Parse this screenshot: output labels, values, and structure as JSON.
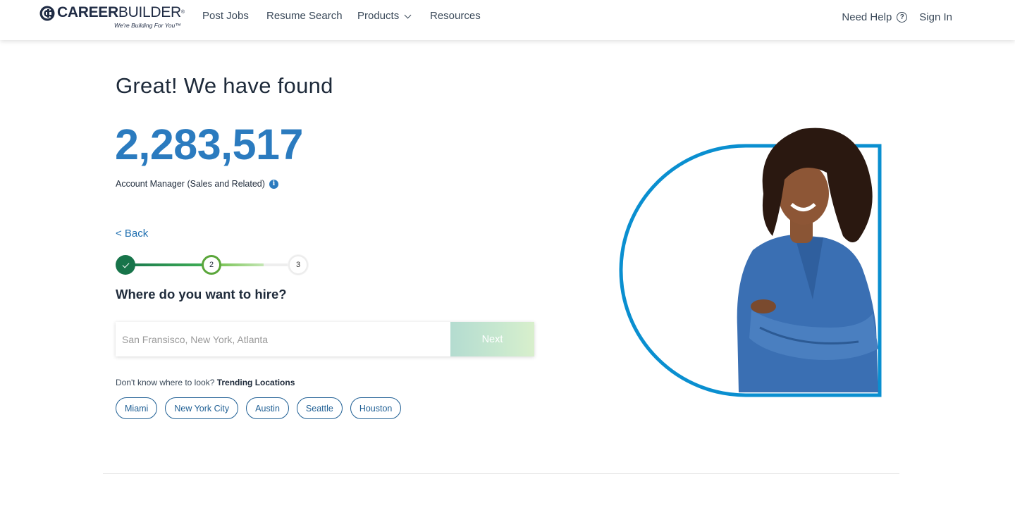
{
  "header": {
    "logo": {
      "brand_bold": "CAREER",
      "brand_light": "BUILDER",
      "reg_mark": "®",
      "tagline": "We're Building For You™"
    },
    "nav": [
      {
        "label": "Post Jobs"
      },
      {
        "label": "Resume Search"
      },
      {
        "label": "Products"
      },
      {
        "label": "Resources"
      }
    ],
    "help_label": "Need Help",
    "help_icon_glyph": "?",
    "sign_in_label": "Sign In"
  },
  "main": {
    "headline": "Great! We have found",
    "count": "2,283,517",
    "job_title": "Account Manager (Sales and Related)",
    "info_icon_glyph": "i",
    "back_label": "< Back",
    "stepper": {
      "current_step": 2,
      "total_steps": 3,
      "step2_label": "2",
      "step3_label": "3"
    },
    "question": "Where do you want to hire?",
    "location_input": {
      "value": "",
      "placeholder": "San Fransisco, New York, Atlanta"
    },
    "next_label": "Next",
    "trending_prefix": "Don't know where to look?",
    "trending_label": "Trending Locations",
    "trending_locations": [
      "Miami",
      "New York City",
      "Austin",
      "Seattle",
      "Houston"
    ]
  },
  "colors": {
    "accent_blue": "#2b7bbf",
    "step_complete": "#17744a",
    "step_current": "#5aa63a",
    "hero_ring": "#0a8fd0"
  },
  "icons": {
    "help": "question-circle-icon",
    "info": "info-icon",
    "check": "check-icon",
    "chevron": "chevron-down-icon"
  }
}
